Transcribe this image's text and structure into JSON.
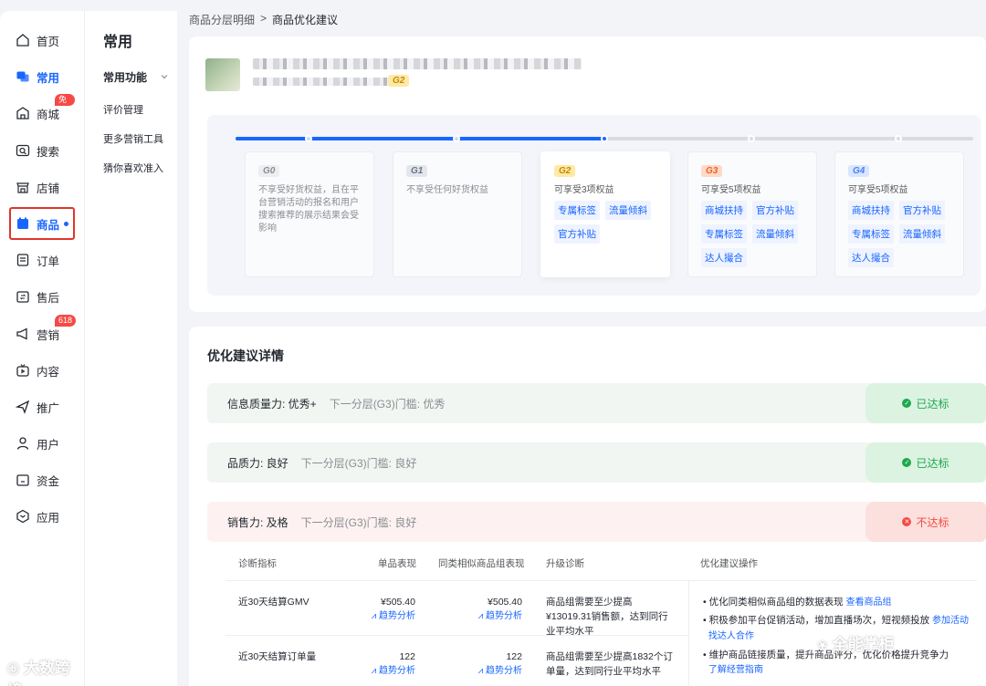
{
  "sidebar": {
    "items": [
      {
        "label": "首页",
        "icon": "home-icon"
      },
      {
        "label": "常用",
        "icon": "stack-icon"
      },
      {
        "label": "商城",
        "icon": "shop-icon",
        "badge": "免佣"
      },
      {
        "label": "搜索",
        "icon": "search-icon"
      },
      {
        "label": "店铺",
        "icon": "store-icon"
      },
      {
        "label": "商品",
        "icon": "goods-icon"
      },
      {
        "label": "订单",
        "icon": "order-icon"
      },
      {
        "label": "售后",
        "icon": "after-sale-icon"
      },
      {
        "label": "营销",
        "icon": "megaphone-icon",
        "badge": "618"
      },
      {
        "label": "内容",
        "icon": "tv-icon"
      },
      {
        "label": "推广",
        "icon": "send-icon"
      },
      {
        "label": "用户",
        "icon": "user-icon"
      },
      {
        "label": "资金",
        "icon": "wallet-icon"
      },
      {
        "label": "应用",
        "icon": "app-icon"
      }
    ]
  },
  "subnav": {
    "title": "常用",
    "group": "常用功能",
    "items": [
      "评价管理",
      "更多营销工具",
      "猜你喜欢准入"
    ]
  },
  "breadcrumb": {
    "parent": "商品分层明细",
    "sep": ">",
    "current": "商品优化建议"
  },
  "product": {
    "level": "G2"
  },
  "levels": [
    {
      "name": "G0",
      "desc": "不享受好货权益，且在平台营销活动的报名和用户搜索推荐的展示结果会受影响",
      "tags": []
    },
    {
      "name": "G1",
      "desc": "不享受任何好货权益",
      "tags": []
    },
    {
      "name": "G2",
      "desc": "可享受3项权益",
      "tags": [
        "专属标签",
        "流量倾斜",
        "官方补贴"
      ]
    },
    {
      "name": "G3",
      "desc": "可享受5项权益",
      "tags": [
        "商城扶持",
        "官方补贴",
        "专属标签",
        "流量倾斜",
        "达人撮合"
      ]
    },
    {
      "name": "G4",
      "desc": "可享受5项权益",
      "tags": [
        "商城扶持",
        "官方补贴",
        "专属标签",
        "流量倾斜",
        "达人撮合"
      ]
    }
  ],
  "details": {
    "title": "优化建议详情",
    "rows": [
      {
        "label": "信息质量力: 优秀+",
        "next": "下一分层(G3)门槛: 优秀",
        "status": "已达标"
      },
      {
        "label": "品质力: 良好",
        "next": "下一分层(G3)门槛: 良好",
        "status": "已达标"
      },
      {
        "label": "销售力: 及格",
        "next": "下一分层(G3)门槛: 良好",
        "status": "不达标"
      }
    ],
    "table": {
      "headers": [
        "诊断指标",
        "单品表现",
        "同类相似商品组表现",
        "升级诊断",
        "优化建议操作"
      ],
      "rows": [
        {
          "metric": "近30天结算GMV",
          "single": "¥505.40",
          "group": "¥505.40",
          "trend": "趋势分析",
          "diagnosis": "商品组需要至少提高¥13019.31销售额，达到同行业平均水平"
        },
        {
          "metric": "近30天结算订单量",
          "single": "122",
          "group": "122",
          "trend": "趋势分析",
          "diagnosis": "商品组需要至少提高1832个订单量，达到同行业平均水平"
        }
      ],
      "suggestions": [
        {
          "text": "优化同类相似商品组的数据表现",
          "link": "查看商品组"
        },
        {
          "text": "积极参加平台促销活动，增加直播场次，短视频投放",
          "link": "参加活动",
          "link2": "找达人合作"
        },
        {
          "text": "维护商品链接质量，提升商品评分，优化价格提升竞争力",
          "link": "了解经营指南"
        }
      ]
    }
  },
  "watermarks": {
    "left": "大数跨境",
    "right": "全能掌柜"
  }
}
